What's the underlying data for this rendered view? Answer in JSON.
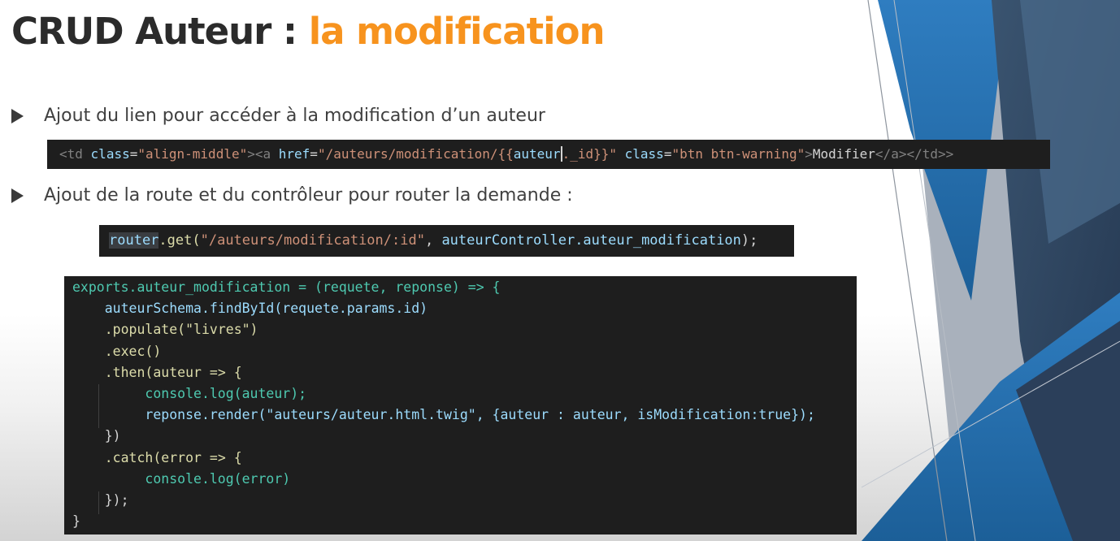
{
  "title": {
    "main": "CRUD Auteur : ",
    "accent": "la modification"
  },
  "bullets": [
    "Ajout du lien pour accéder à la modification d’un auteur",
    "Ajout de la route et du contrôleur pour router la demande :"
  ],
  "code_html_template": {
    "td_open": "<td",
    "class_attr": "class",
    "class_val": "\"align-middle\"",
    "a_open": "<a",
    "href_attr": "href",
    "href_start": "\"/auteurs/modification/{{",
    "var": "auteur",
    "href_end": "._id}}\"",
    "class_val2": "\"btn btn-warning\"",
    "link_text": "Modifier",
    "a_close": "</a>",
    "td_close": "</td>"
  },
  "code_route": {
    "obj": "router",
    "method": ".get(",
    "path": "\"/auteurs/modification/:id\"",
    "handler": "auteurController.auteur_modification",
    "end": ");"
  },
  "code_controller": [
    "exports.auteur_modification = (requete, reponse) => {",
    "auteurSchema.findById(requete.params.id)",
    ".populate(\"livres\")",
    ".exec()",
    ".then(auteur => {",
    "console.log(auteur);",
    "reponse.render(\"auteurs/auteur.html.twig\", {auteur : auteur, isModification:true});",
    "})",
    ".catch(error => {",
    "console.log(error)",
    "});",
    "}"
  ],
  "colors": {
    "accent": "#f7931e",
    "title": "#2b2b2b",
    "code_bg": "#1e1e1e",
    "deco_blue": "#3d86c1",
    "deco_navy": "#2b3f5a"
  }
}
